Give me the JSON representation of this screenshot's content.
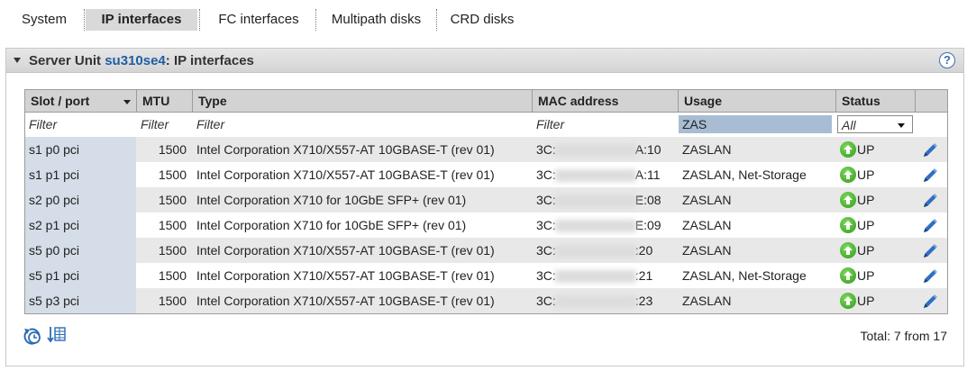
{
  "tabs": [
    {
      "label": "System"
    },
    {
      "label": "IP interfaces"
    },
    {
      "label": "FC interfaces"
    },
    {
      "label": "Multipath disks"
    },
    {
      "label": "CRD disks"
    }
  ],
  "panel": {
    "title_prefix": "Server Unit",
    "server_name": "su310se4",
    "title_suffix": ":  IP interfaces",
    "help_label": "?"
  },
  "table": {
    "columns": [
      "Slot / port",
      "MTU",
      "Type",
      "MAC address",
      "Usage",
      "Status"
    ],
    "filters": {
      "slot": "Filter",
      "mtu": "Filter",
      "type": "Filter",
      "mac": "Filter",
      "usage": "ZAS",
      "status": "All"
    },
    "rows": [
      {
        "slot": "s1 p0 pci",
        "mtu": "1500",
        "type": "Intel Corporation X710/X557-AT 10GBASE-T (rev 01)",
        "mac_start": "3C:",
        "mac_end": "A:10",
        "usage": "ZASLAN",
        "status": "UP"
      },
      {
        "slot": "s1 p1 pci",
        "mtu": "1500",
        "type": "Intel Corporation X710/X557-AT 10GBASE-T (rev 01)",
        "mac_start": "3C:",
        "mac_end": "A:11",
        "usage": "ZASLAN, Net-Storage",
        "status": "UP"
      },
      {
        "slot": "s2 p0 pci",
        "mtu": "1500",
        "type": "Intel Corporation X710 for 10GbE SFP+ (rev 01)",
        "mac_start": "3C:",
        "mac_end": "E:08",
        "usage": "ZASLAN",
        "status": "UP"
      },
      {
        "slot": "s2 p1 pci",
        "mtu": "1500",
        "type": "Intel Corporation X710 for 10GbE SFP+ (rev 01)",
        "mac_start": "3C:",
        "mac_end": "E:09",
        "usage": "ZASLAN",
        "status": "UP"
      },
      {
        "slot": "s5 p0 pci",
        "mtu": "1500",
        "type": "Intel Corporation X710/X557-AT 10GBASE-T (rev 01)",
        "mac_start": "3C:",
        "mac_end": ":20",
        "usage": "ZASLAN",
        "status": "UP"
      },
      {
        "slot": "s5 p1 pci",
        "mtu": "1500",
        "type": "Intel Corporation X710/X557-AT 10GBASE-T (rev 01)",
        "mac_start": "3C:",
        "mac_end": ":21",
        "usage": "ZASLAN, Net-Storage",
        "status": "UP"
      },
      {
        "slot": "s5 p3 pci",
        "mtu": "1500",
        "type": "Intel Corporation X710/X557-AT 10GBASE-T (rev 01)",
        "mac_start": "3C:",
        "mac_end": ":23",
        "usage": "ZASLAN",
        "status": "UP"
      }
    ]
  },
  "footer": {
    "total_label": "Total: 7 from 17",
    "icons": [
      "refresh-clock-icon",
      "table-export-icon"
    ]
  },
  "colors": {
    "accent_link": "#1d5ea3",
    "status_up": "#3aa51f",
    "header_bg": "#d3d3d3",
    "filter_active_bg": "#a8bdd3"
  }
}
